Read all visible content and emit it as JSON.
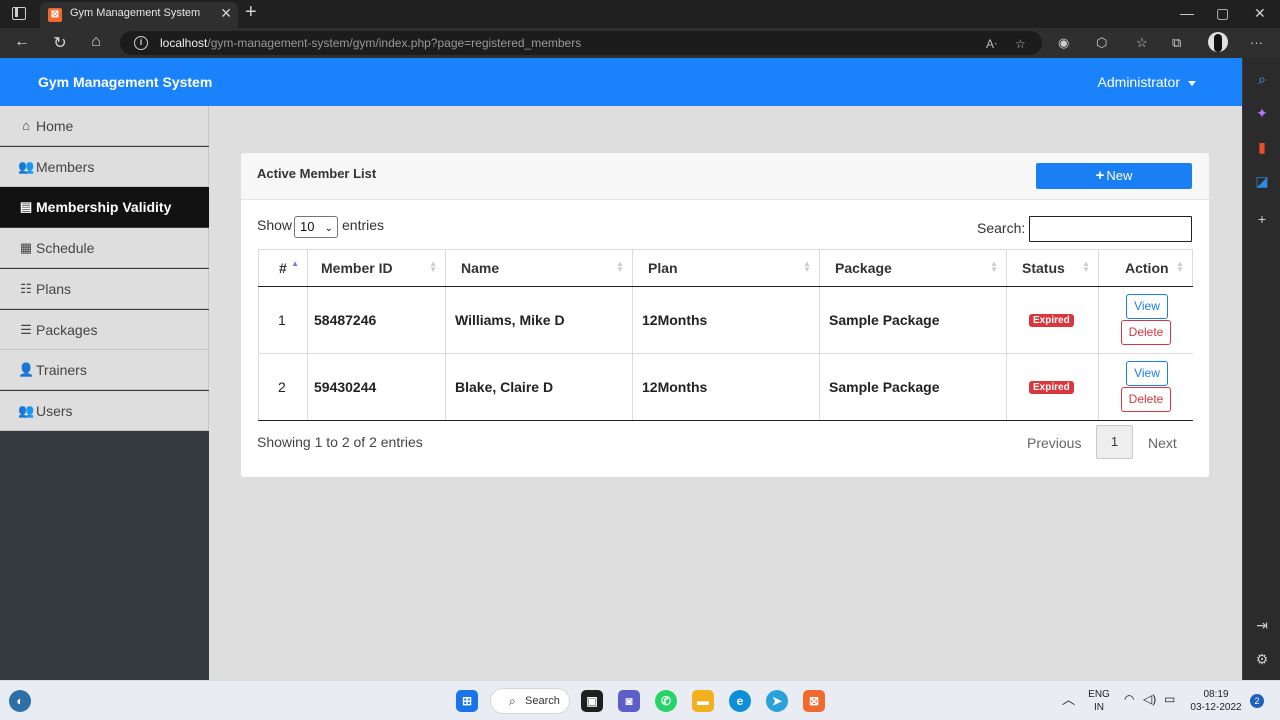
{
  "browser": {
    "tab_title": "Gym Management System",
    "tab_close": "✕",
    "new_tab": "+",
    "url_host": "localhost",
    "url_path": "/gym-management-system/gym/index.php?page=registered_members",
    "window_controls": [
      "—",
      "▢",
      "✕"
    ]
  },
  "app": {
    "brand": "Gym Management System",
    "user_menu": "Administrator"
  },
  "sidebar": {
    "items": [
      {
        "label": "Home",
        "icon": "home-icon",
        "glyph": "⌂",
        "active": false
      },
      {
        "label": "Members",
        "icon": "users-icon",
        "glyph": "👥",
        "active": false
      },
      {
        "label": "Membership Validity",
        "icon": "id-card-icon",
        "glyph": "▤",
        "active": true
      },
      {
        "label": "Schedule",
        "icon": "calendar-icon",
        "glyph": "▦",
        "active": false
      },
      {
        "label": "Plans",
        "icon": "th-list-icon",
        "glyph": "☷",
        "active": false
      },
      {
        "label": "Packages",
        "icon": "list-icon",
        "glyph": "☰",
        "active": false
      },
      {
        "label": "Trainers",
        "icon": "user-icon",
        "glyph": "👤",
        "active": false
      },
      {
        "label": "Users",
        "icon": "users-cog-icon",
        "glyph": "👥",
        "active": false
      }
    ]
  },
  "card": {
    "title": "Active Member List",
    "new_button": "New",
    "show_label": "Show",
    "entries_value": "10",
    "entries_label": "entries",
    "search_label": "Search:",
    "search_value": "",
    "columns": [
      "#",
      "Member ID",
      "Name",
      "Plan",
      "Package",
      "Status",
      "Action"
    ],
    "rows": [
      {
        "num": "1",
        "member_id": "58487246",
        "name": "Williams, Mike D",
        "plan": "12Months",
        "package": "Sample Package",
        "status": "Expired",
        "view": "View",
        "delete": "Delete"
      },
      {
        "num": "2",
        "member_id": "59430244",
        "name": "Blake, Claire D",
        "plan": "12Months",
        "package": "Sample Package",
        "status": "Expired",
        "view": "View",
        "delete": "Delete"
      }
    ],
    "info": "Showing 1 to 2 of 2 entries",
    "pagination": {
      "previous": "Previous",
      "current": "1",
      "next": "Next"
    }
  },
  "taskbar": {
    "search": "Search",
    "lang_top": "ENG",
    "lang_bottom": "IN",
    "time": "08:19",
    "date": "03-12-2022",
    "notifications": "2"
  },
  "colors": {
    "primary": "#1a82fb",
    "danger": "#d9363e",
    "sidebar_active": "#121212"
  }
}
